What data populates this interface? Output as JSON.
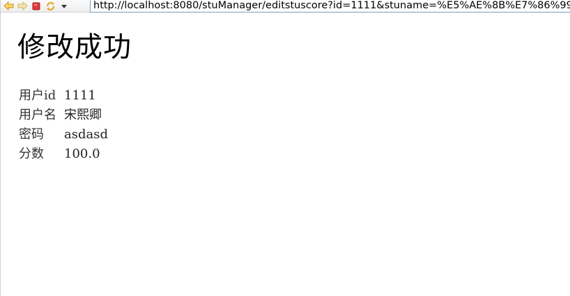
{
  "browser": {
    "url": "http://localhost:8080/stuManager/editstuscore?id=1111&stuname=%E5%AE%8B%E7%86%99"
  },
  "page": {
    "title": "修改成功"
  },
  "details": [
    {
      "label": "用户id",
      "value": "1111"
    },
    {
      "label": "用户名",
      "value": "宋熙卿"
    },
    {
      "label": "密码",
      "value": "asdasd"
    },
    {
      "label": "分数",
      "value": "100.0"
    }
  ],
  "icons": {
    "back": "back-arrow-icon",
    "forward": "forward-arrow-icon",
    "stop": "stop-icon",
    "refresh": "refresh-icon",
    "menu": "dropdown-triangle-icon"
  },
  "colors": {
    "nav_arrows": "#e8b93a",
    "stop": "#d42b2b",
    "url_border": "#7a9ebd"
  }
}
